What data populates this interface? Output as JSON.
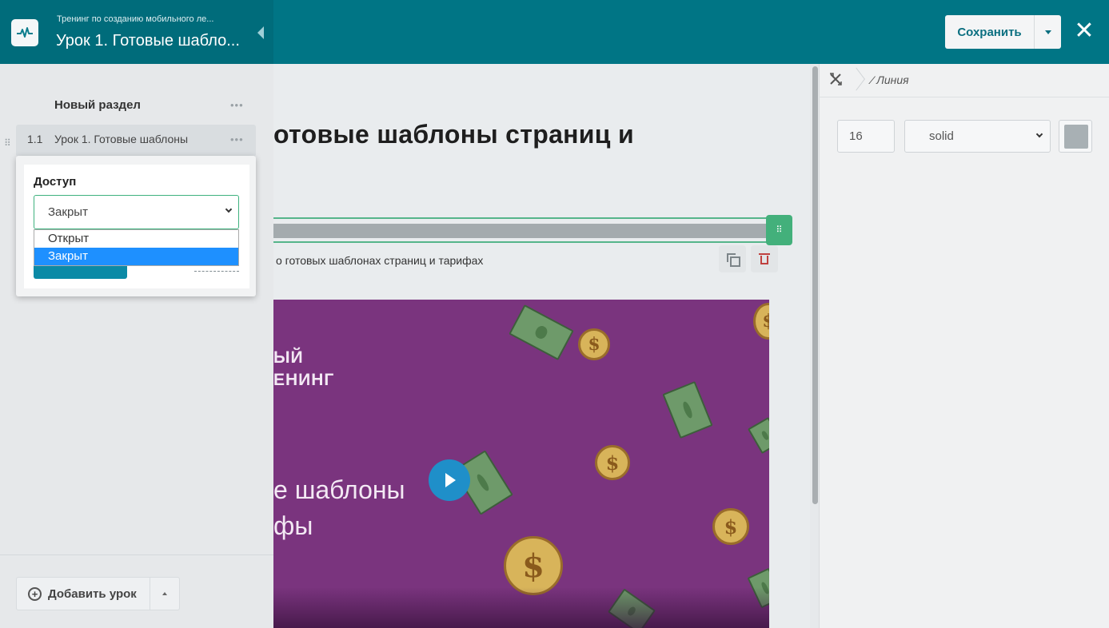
{
  "header": {
    "course_title": "Тренинг по созданию мобильного ле...",
    "lesson_title": "Урок 1. Готовые шабло...",
    "save_label": "Сохранить",
    "close_glyph": "✕"
  },
  "sidebar": {
    "section_title": "Новый раздел",
    "more_glyph": "•••",
    "lesson": {
      "number": "1.1",
      "name": "Урок 1. Готовые шаблоны"
    },
    "add_lesson_label": "Добавить урок"
  },
  "access_popover": {
    "label": "Доступ",
    "selected": "Закрыт",
    "options": [
      "Открыт",
      "Закрыт"
    ],
    "highlighted_option": "Закрыт",
    "highlight_color": "#1e90ff"
  },
  "editor": {
    "heading": "отовые шаблоны страниц и",
    "caption": "о готовых шаблонах страниц и тарифах",
    "video_lines": [
      "ЫЙ",
      "ЕНИНГ",
      "е шаблоны",
      "фы"
    ]
  },
  "right_panel": {
    "breadcrumb": "⁄ Линия",
    "line_width": "16",
    "line_style": "solid",
    "line_style_options": [
      "solid"
    ],
    "line_color": "#a8b0b4"
  },
  "colors": {
    "header_bg": "#007585",
    "accent_green": "#43b07b",
    "delete_red": "#c0413f",
    "video_bg": "#7a347e"
  }
}
